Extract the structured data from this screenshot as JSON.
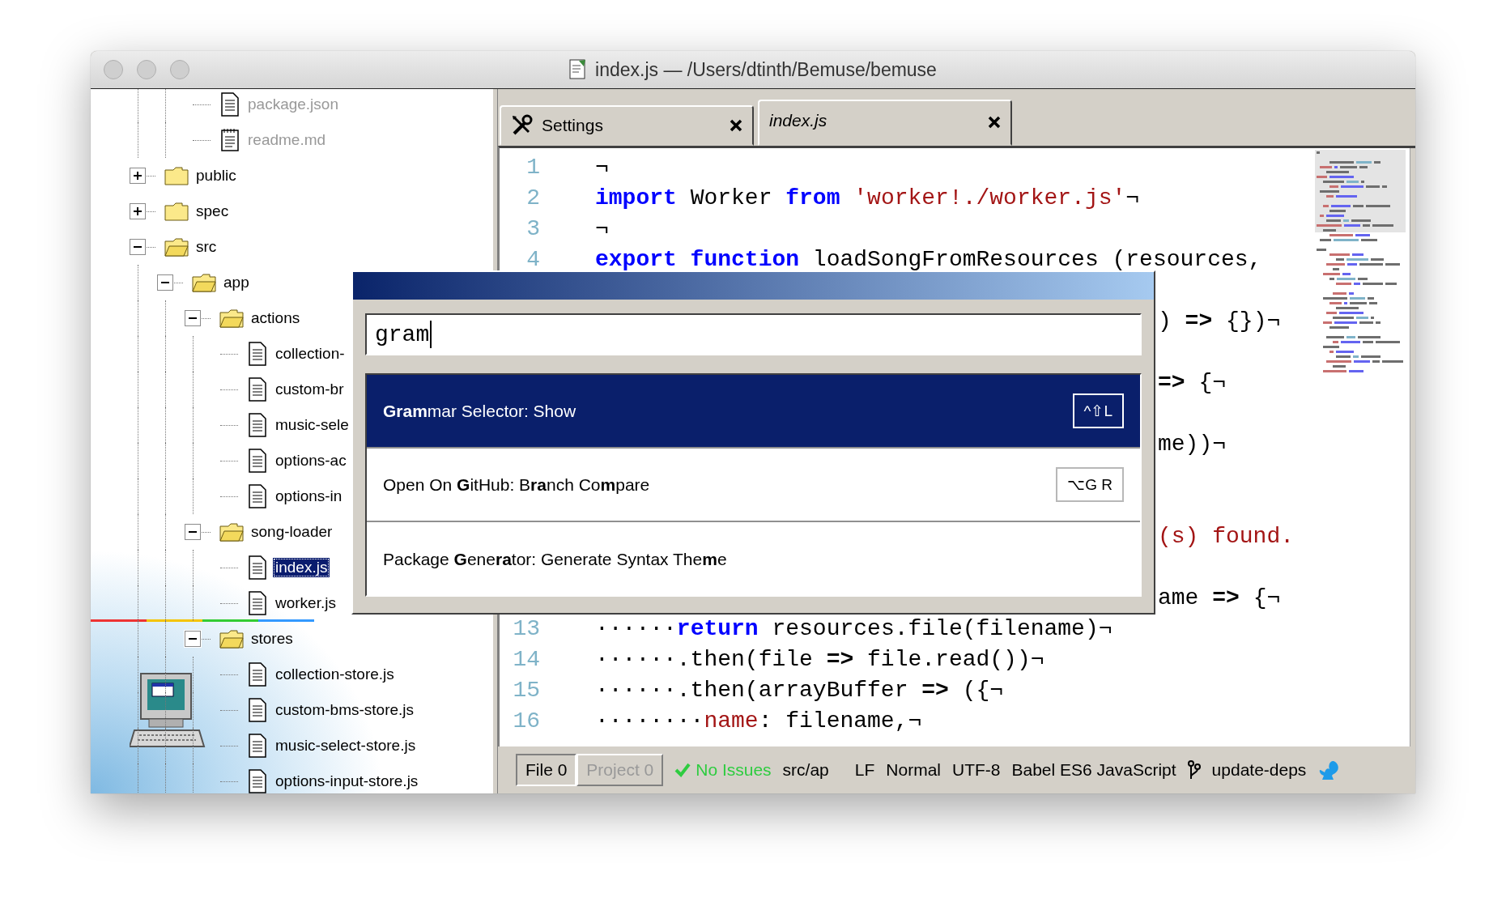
{
  "window": {
    "title": "index.js — /Users/dtinth/Bemuse/bemuse"
  },
  "tree": {
    "items": [
      {
        "children": [
          {
            "children": [
              {
                "name": "package.json",
                "kind": "file",
                "dimmed": true,
                "selected": false
              },
              {
                "name": "readme.md",
                "kind": "notepad",
                "dimmed": true,
                "selected": false
              }
            ]
          }
        ]
      },
      {
        "name": "public",
        "kind": "folder",
        "expanded": false,
        "dimmed": false,
        "selected": false
      },
      {
        "name": "spec",
        "kind": "folder",
        "expanded": false,
        "dimmed": false,
        "selected": false
      },
      {
        "name": "src",
        "kind": "folder",
        "expanded": true,
        "dimmed": false,
        "selected": false,
        "children": [
          {
            "name": "app",
            "kind": "folder",
            "expanded": true,
            "dimmed": false,
            "selected": false,
            "children": [
              {
                "name": "actions",
                "kind": "folder",
                "expanded": true,
                "dimmed": false,
                "selected": false,
                "children": [
                  {
                    "name": "collection-",
                    "kind": "file",
                    "dimmed": false,
                    "selected": false
                  },
                  {
                    "name": "custom-br",
                    "kind": "file",
                    "dimmed": false,
                    "selected": false
                  },
                  {
                    "name": "music-sele",
                    "kind": "file",
                    "dimmed": false,
                    "selected": false
                  },
                  {
                    "name": "options-ac",
                    "kind": "file",
                    "dimmed": false,
                    "selected": false
                  },
                  {
                    "name": "options-in",
                    "kind": "file",
                    "dimmed": false,
                    "selected": false
                  }
                ]
              },
              {
                "name": "song-loader",
                "kind": "folder",
                "expanded": true,
                "dimmed": false,
                "selected": false,
                "children": [
                  {
                    "name": "index.js",
                    "kind": "file",
                    "dimmed": false,
                    "selected": true
                  },
                  {
                    "name": "worker.js",
                    "kind": "file",
                    "dimmed": false,
                    "selected": false
                  }
                ]
              },
              {
                "name": "stores",
                "kind": "folder",
                "expanded": true,
                "dimmed": false,
                "selected": false,
                "children": [
                  {
                    "name": "collection-store.js",
                    "kind": "file",
                    "dimmed": false,
                    "selected": false
                  },
                  {
                    "name": "custom-bms-store.js",
                    "kind": "file",
                    "dimmed": false,
                    "selected": false
                  },
                  {
                    "name": "music-select-store.js",
                    "kind": "file",
                    "dimmed": false,
                    "selected": false
                  },
                  {
                    "name": "options-input-store.js",
                    "kind": "file",
                    "dimmed": false,
                    "selected": false
                  }
                ]
              }
            ]
          }
        ]
      }
    ]
  },
  "tabs": [
    {
      "label": "Settings",
      "kind": "settings",
      "selected": false,
      "preview": false
    },
    {
      "label": "index.js",
      "kind": "file",
      "selected": true,
      "preview": true
    }
  ],
  "editor": {
    "rows": [
      {
        "kind": "line",
        "number": "1",
        "tokens": [
          {
            "kind": "plain",
            "text": "¬"
          }
        ]
      },
      {
        "kind": "line",
        "number": "2",
        "tokens": [
          {
            "kind": "kw",
            "text": "import"
          },
          {
            "kind": "plain",
            "text": " Worker "
          },
          {
            "kind": "kw",
            "text": "from"
          },
          {
            "kind": "str",
            "text": " 'worker!./worker.js'"
          },
          {
            "kind": "plain",
            "text": "¬"
          }
        ]
      },
      {
        "kind": "line",
        "number": "3",
        "tokens": [
          {
            "kind": "plain",
            "text": "¬"
          }
        ]
      },
      {
        "kind": "line",
        "number": "4",
        "tokens": [
          {
            "kind": "kw",
            "text": "export function"
          },
          {
            "kind": "plain",
            "text": " loadSongFromResources (resources,"
          }
        ]
      },
      {
        "kind": "covered"
      },
      {
        "kind": "clipped",
        "tokens": [
          {
            "kind": "plain",
            "text": ") "
          },
          {
            "kind": "op",
            "text": "=>"
          },
          {
            "kind": "plain",
            "text": " {})¬"
          }
        ]
      },
      {
        "kind": "covered"
      },
      {
        "kind": "clipped",
        "tokens": [
          {
            "kind": "op",
            "text": "=>"
          },
          {
            "kind": "plain",
            "text": " {¬"
          }
        ]
      },
      {
        "kind": "covered"
      },
      {
        "kind": "clipped",
        "tokens": [
          {
            "kind": "plain",
            "text": "me))¬"
          }
        ]
      },
      {
        "kind": "covered"
      },
      {
        "kind": "covered"
      },
      {
        "kind": "clipped",
        "tokens": [
          {
            "kind": "str",
            "text": "(s) found."
          }
        ]
      },
      {
        "kind": "covered"
      },
      {
        "kind": "clipped",
        "tokens": [
          {
            "kind": "plain",
            "text": "ame "
          },
          {
            "kind": "op",
            "text": "=>"
          },
          {
            "kind": "plain",
            "text": " {¬"
          }
        ]
      },
      {
        "kind": "line",
        "number": "13",
        "tokens": [
          {
            "kind": "plain",
            "text": "······"
          },
          {
            "kind": "kw",
            "text": "return"
          },
          {
            "kind": "plain",
            "text": " resources.file(filename)¬"
          }
        ]
      },
      {
        "kind": "line",
        "number": "14",
        "tokens": [
          {
            "kind": "plain",
            "text": "······.then(file "
          },
          {
            "kind": "op",
            "text": "=>"
          },
          {
            "kind": "plain",
            "text": " file.read())¬"
          }
        ]
      },
      {
        "kind": "line",
        "number": "15",
        "tokens": [
          {
            "kind": "plain",
            "text": "······.then(arrayBuffer "
          },
          {
            "kind": "op",
            "text": "=>"
          },
          {
            "kind": "plain",
            "text": " ({¬"
          }
        ]
      },
      {
        "kind": "line",
        "number": "16",
        "tokens": [
          {
            "kind": "plain",
            "text": "········"
          },
          {
            "kind": "prop",
            "text": "name"
          },
          {
            "kind": "plain",
            "text": ": filename,¬"
          }
        ]
      }
    ]
  },
  "command_palette": {
    "query": "gram",
    "items": [
      {
        "label": "**Gram**mar Selector: Show",
        "keys": "^⇧L",
        "selected": true
      },
      {
        "label": "Open On **G**itHub: B**ra**nch Co**m**pare",
        "keys": "⌥G R",
        "selected": false
      },
      {
        "label": "Package **G**ene**ra**tor: Generate Syntax The**m**e",
        "selected": false
      }
    ]
  },
  "status_bar": {
    "scopes": [
      {
        "label": "File 0",
        "selected": true
      },
      {
        "label": "Project 0",
        "selected": false
      }
    ],
    "lint": "No Issues",
    "path": "src/ap",
    "line_ending": "LF",
    "mode": "Normal",
    "encoding": "UTF-8",
    "grammar": "Babel ES6 JavaScript",
    "branch": "update-deps"
  }
}
